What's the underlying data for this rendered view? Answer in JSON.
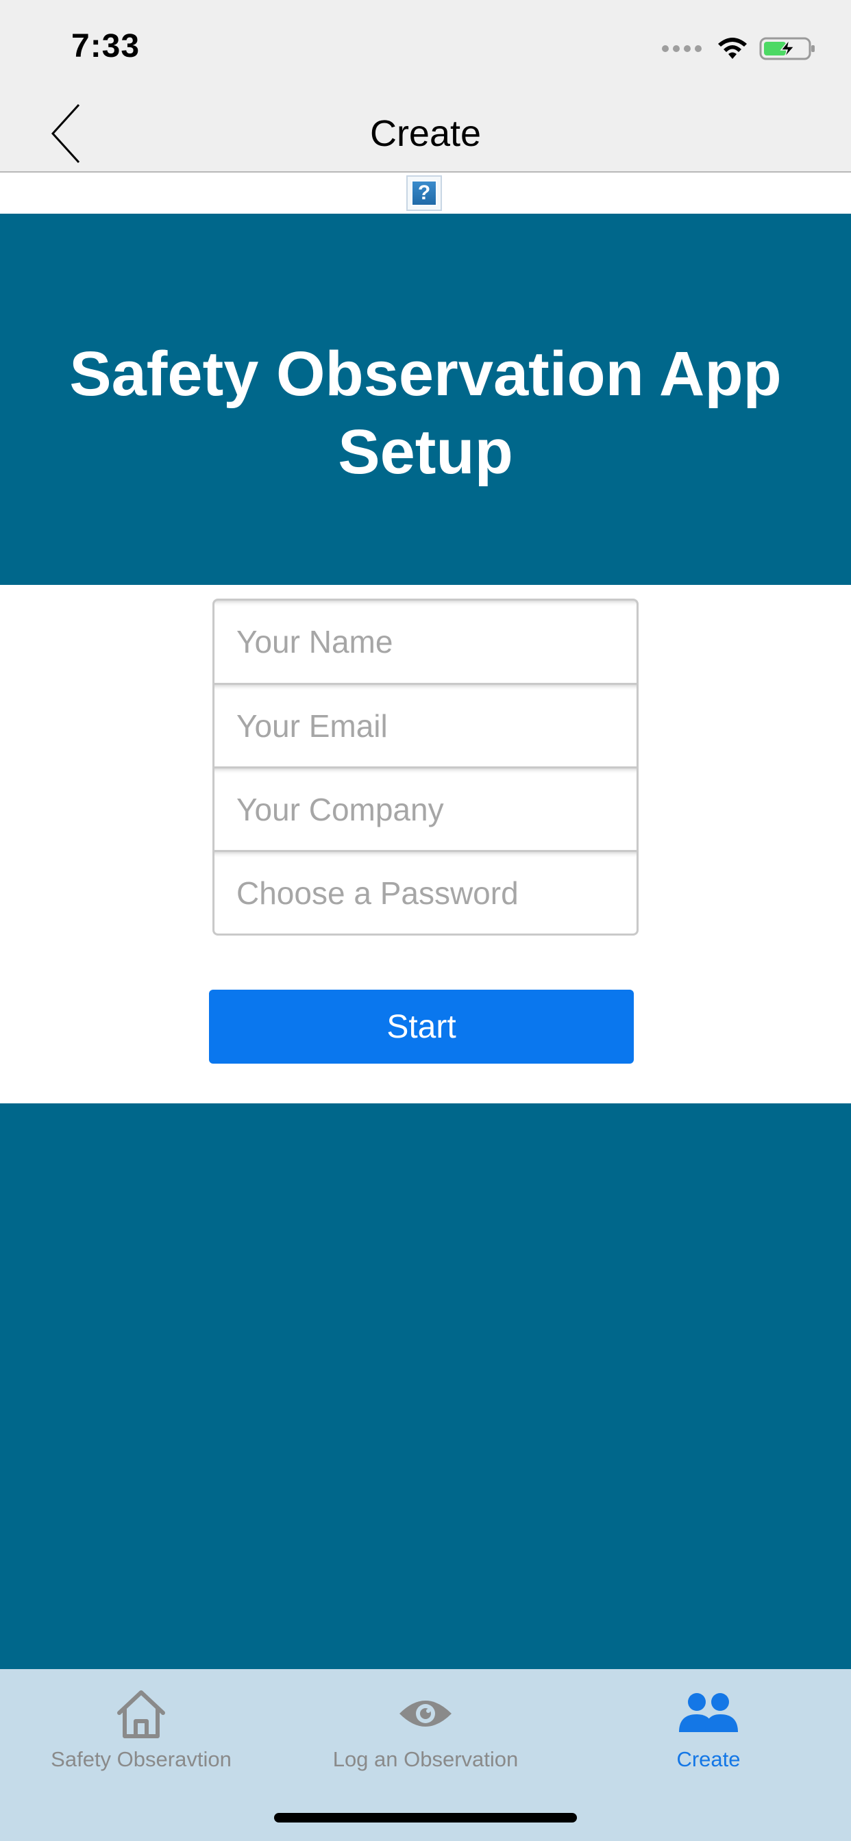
{
  "status_bar": {
    "time": "7:33"
  },
  "nav": {
    "title": "Create",
    "back_icon": "chevron-left-icon"
  },
  "help": {
    "glyph": "?"
  },
  "hero": {
    "title": "Safety Observation App Setup"
  },
  "form": {
    "fields": [
      {
        "placeholder": "Your Name",
        "value": ""
      },
      {
        "placeholder": "Your Email",
        "value": ""
      },
      {
        "placeholder": "Your Company",
        "value": ""
      },
      {
        "placeholder": "Choose a Password",
        "value": ""
      }
    ],
    "start_label": "Start"
  },
  "tabs": [
    {
      "label": "Safety Obseravtion",
      "icon": "home-icon",
      "active": false
    },
    {
      "label": "Log an Observation",
      "icon": "eye-icon",
      "active": false
    },
    {
      "label": "Create",
      "icon": "people-icon",
      "active": true
    }
  ],
  "colors": {
    "brand_blue": "#00678b",
    "accent_blue": "#0a77ee",
    "tab_active": "#1477e6",
    "tab_inactive": "#8a8a8a",
    "tab_bar_bg": "#c5dbe9",
    "battery_green": "#4cd964"
  }
}
